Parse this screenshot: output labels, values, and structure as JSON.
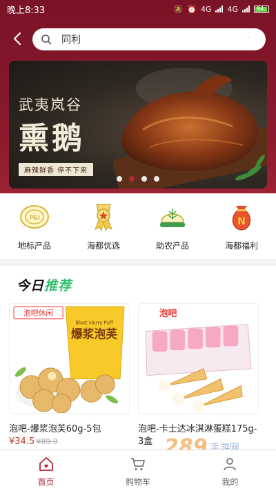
{
  "status_bar": {
    "time": "晚上8:33",
    "network_1": "4G",
    "network_2": "4G",
    "battery": "94"
  },
  "search": {
    "value": "同利",
    "placeholder": ""
  },
  "banner": {
    "line1": "武夷岚谷",
    "line2": "熏鹅",
    "tagline": "麻辣鲜香 停不下来",
    "slide_count": 4,
    "active_slide": 1
  },
  "categories": [
    {
      "label": "地标产品",
      "icon": "landmark-badge-icon"
    },
    {
      "label": "海都优选",
      "icon": "medal-star-icon"
    },
    {
      "label": "助农产品",
      "icon": "farm-helmet-icon"
    },
    {
      "label": "海都福利",
      "icon": "lucky-bag-icon"
    }
  ],
  "recommend": {
    "title_part1": "今日",
    "title_part2": "推荐",
    "products": [
      {
        "name": "泡吧-爆浆泡芙60g-5包",
        "price": "¥34.5",
        "old_price": "¥89.9",
        "brand": "泡吧休闲",
        "pack_text": "爆浆泡芙",
        "pack_sub": "Blast slurry Puff"
      },
      {
        "name": "泡吧-卡士达冰淇淋蛋糕175g-3盒",
        "price": "",
        "old_price": "",
        "brand": "泡吧",
        "pack_text": "",
        "pack_sub": ""
      }
    ]
  },
  "watermark": {
    "number": "289",
    "text": "手游网"
  },
  "tabbar": [
    {
      "label": "首页",
      "icon": "home-icon",
      "active": true
    },
    {
      "label": "购物车",
      "icon": "cart-icon",
      "active": false
    },
    {
      "label": "我的",
      "icon": "user-icon",
      "active": false
    }
  ],
  "colors": {
    "header": "#8b1a2d",
    "accent": "#b22234",
    "price": "#c0392b",
    "green": "#2fbf6b"
  }
}
